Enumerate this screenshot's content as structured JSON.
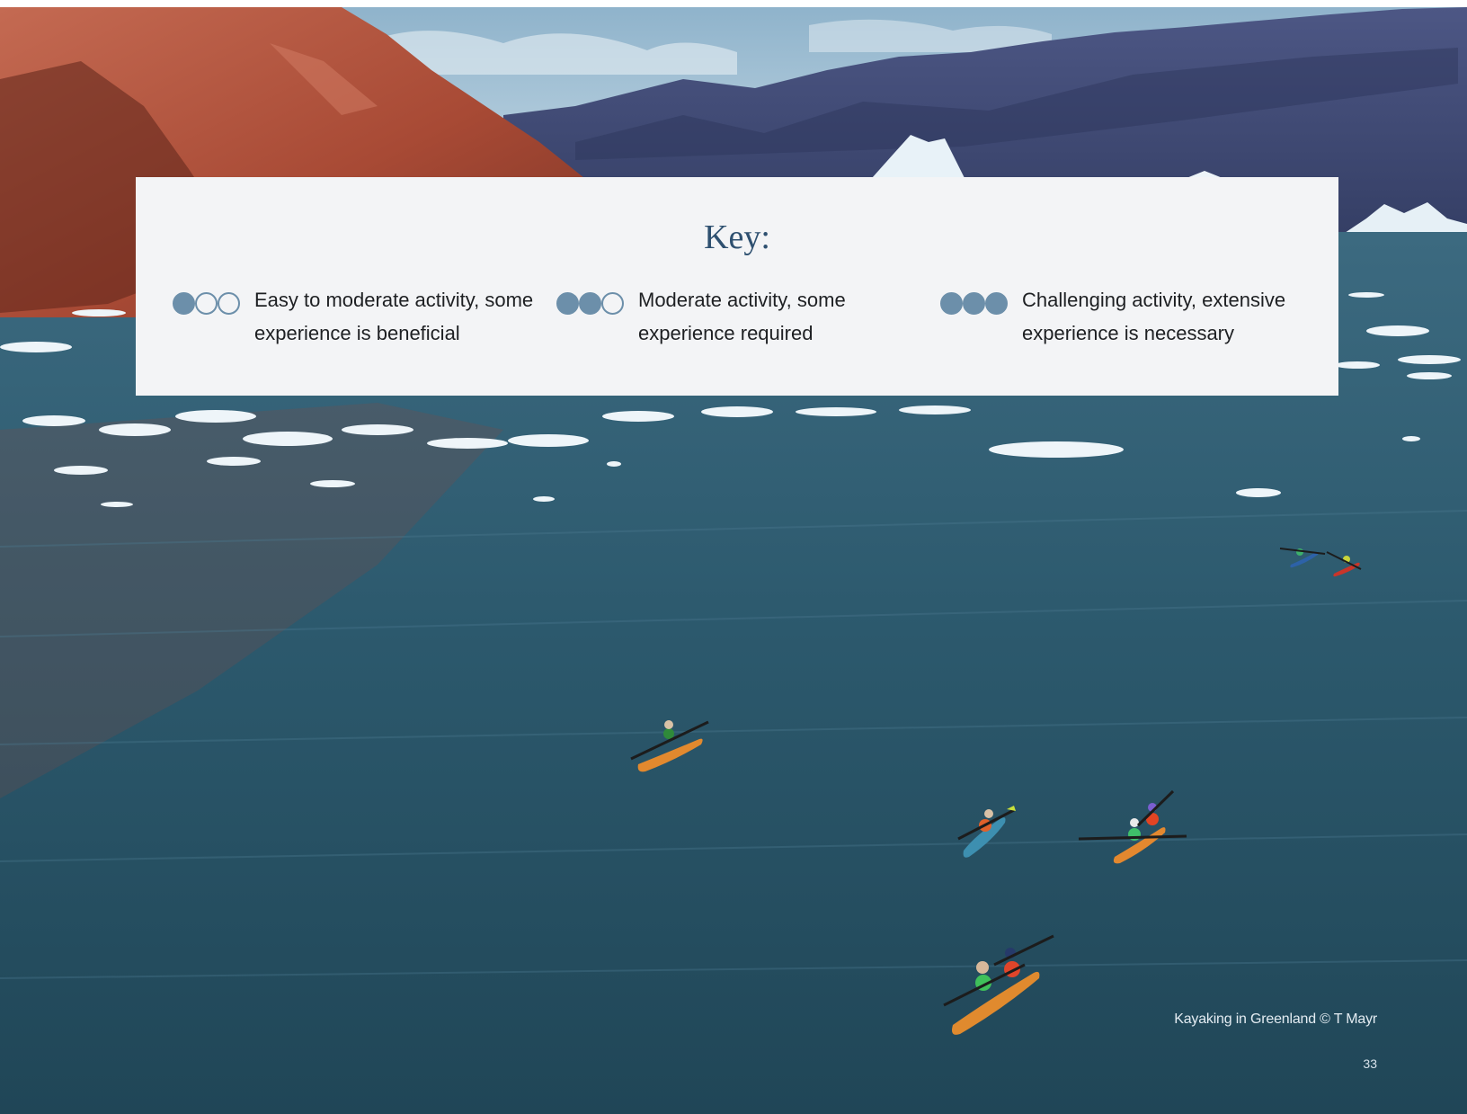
{
  "photo": {
    "description_icon": "photo-landscape-icon",
    "colors": {
      "water": "#2a5568",
      "sky": "#a9c7db",
      "cliff": "#b4553f",
      "mountains": "#3e4a73",
      "ice": "#f0f6fa"
    }
  },
  "key": {
    "title": "Key:",
    "accent_color": "#6c8faa",
    "items": [
      {
        "level": 1,
        "of": 3,
        "icon": "difficulty-dots-1-of-3-icon",
        "description": "Easy to moderate activity, some experience is beneficial"
      },
      {
        "level": 2,
        "of": 3,
        "icon": "difficulty-dots-2-of-3-icon",
        "description": "Moderate activity, some experience required"
      },
      {
        "level": 3,
        "of": 3,
        "icon": "difficulty-dots-3-of-3-icon",
        "description": "Challenging activity, extensive experience is necessary"
      }
    ]
  },
  "caption": "Kayaking in Greenland © T Mayr",
  "page_number": "33"
}
